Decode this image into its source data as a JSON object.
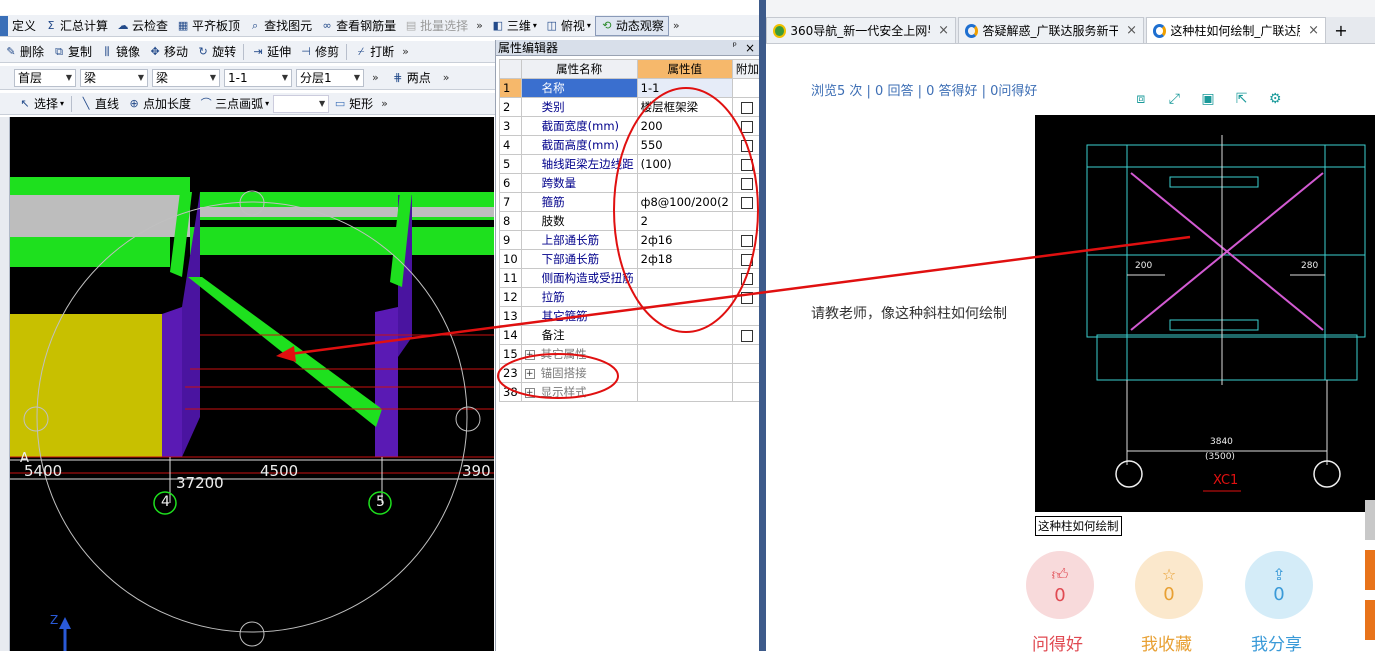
{
  "cad_app": {
    "toolbar1": {
      "define": "定义",
      "sum_calc": "汇总计算",
      "cloud_check": "云检查",
      "flush_slab_top": "平齐板顶",
      "find_element": "查找图元",
      "view_rebar_qty": "查看钢筋量",
      "batch_select": "批量选择",
      "view_3d": "三维",
      "view_top": "俯视",
      "dynamic_observe": "动态观察"
    },
    "toolbar2": {
      "delete": "删除",
      "copy": "复制",
      "mirror": "镜像",
      "move": "移动",
      "rotate": "旋转",
      "extend": "延伸",
      "trim": "修剪",
      "break": "打断"
    },
    "toolbar3": {
      "floor": "首层",
      "category": "梁",
      "type": "梁",
      "name": "1-1",
      "layer": "分层1",
      "two_points": "两点"
    },
    "toolbar4": {
      "select": "选择",
      "line": "直线",
      "point_extend": "点加长度",
      "three_point_arc": "三点画弧",
      "rectangle": "矩形"
    },
    "viewport": {
      "axis_a": "A",
      "dim_5400": "5400",
      "dim_37200": "37200",
      "dim_4500": "4500",
      "dim_3900": "390",
      "axis_4": "4",
      "axis_5": "5",
      "z_label": "Z"
    },
    "property_editor": {
      "title": "属性编辑器",
      "pin": "ᵖ",
      "close": "×",
      "headers": {
        "name": "属性名称",
        "value": "属性值",
        "extra": "附加"
      },
      "rows": [
        {
          "no": "1",
          "name": "名称",
          "value": "1-1",
          "checkbox": false
        },
        {
          "no": "2",
          "name": "类别",
          "value": "楼层框架梁",
          "checkbox": true
        },
        {
          "no": "3",
          "name": "截面宽度(mm)",
          "value": "200",
          "checkbox": true
        },
        {
          "no": "4",
          "name": "截面高度(mm)",
          "value": "550",
          "checkbox": true
        },
        {
          "no": "5",
          "name": "轴线距梁左边线距",
          "value": "(100)",
          "checkbox": true
        },
        {
          "no": "6",
          "name": "跨数量",
          "value": "",
          "checkbox": true
        },
        {
          "no": "7",
          "name": "箍筋",
          "value": "ф8@100/200(2",
          "checkbox": true
        },
        {
          "no": "8",
          "name": "肢数",
          "value": "2",
          "checkbox": false
        },
        {
          "no": "9",
          "name": "上部通长筋",
          "value": "2ф16",
          "checkbox": true
        },
        {
          "no": "10",
          "name": "下部通长筋",
          "value": "2ф18",
          "checkbox": true
        },
        {
          "no": "11",
          "name": "侧面构造或受扭筋",
          "value": "",
          "checkbox": true
        },
        {
          "no": "12",
          "name": "拉筋",
          "value": "",
          "checkbox": true
        },
        {
          "no": "13",
          "name": "其它箍筋",
          "value": "",
          "checkbox": false
        },
        {
          "no": "14",
          "name": "备注",
          "value": "",
          "checkbox": true
        },
        {
          "no": "15",
          "name": "其它属性",
          "value": "",
          "checkbox": false
        },
        {
          "no": "23",
          "name": "锚固搭接",
          "value": "",
          "checkbox": false
        },
        {
          "no": "38",
          "name": "显示样式",
          "value": "",
          "checkbox": false
        }
      ]
    }
  },
  "browser": {
    "tabs": [
      {
        "label": "360导航_新一代安全上网导"
      },
      {
        "label": "答疑解惑_广联达服务新干"
      },
      {
        "label": "这种柱如何绘制_广联达服"
      }
    ],
    "new_tab": "+",
    "stats": "浏览5 次 | 0 回答 | 0 答得好 | 0问得好",
    "question": "请教老师，像这种斜柱如何绘制",
    "caption": "这种柱如何绘制",
    "cad_texts": {
      "dim_200": "200",
      "dim_280": "280",
      "dim_3840": "3840",
      "dim_3500": "(3500)",
      "title": "XC1"
    },
    "actions": [
      {
        "label": "问得好",
        "count": "0"
      },
      {
        "label": "我收藏",
        "count": "0"
      },
      {
        "label": "我分享",
        "count": "0"
      }
    ]
  },
  "colors": {
    "beam_green": "#1ee01e",
    "column_purple": "#5a1ab4",
    "wall_yellow": "#c8c000",
    "slab_grey": "#bdbdbd",
    "annotation_red": "#e01010",
    "header_orange": "#f6b86b",
    "link_blue": "#3e6fb5"
  }
}
